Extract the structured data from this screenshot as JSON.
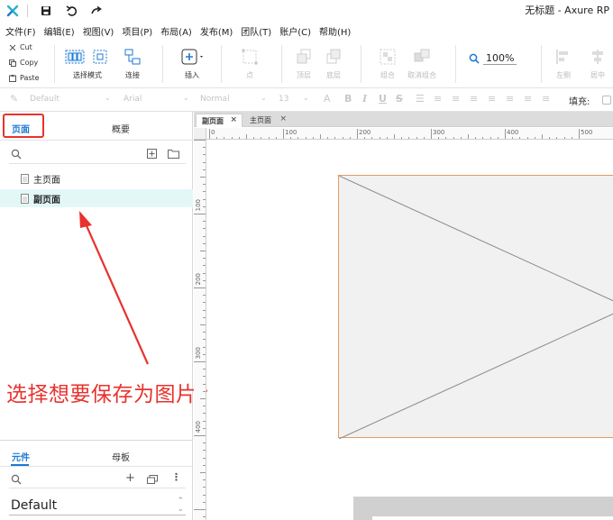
{
  "app": {
    "title": "无标题 - Axure RP"
  },
  "menu": [
    "文件(F)",
    "编辑(E)",
    "视图(V)",
    "项目(P)",
    "布局(A)",
    "发布(M)",
    "团队(T)",
    "账户(C)",
    "帮助(H)"
  ],
  "clipboard": {
    "cut": "Cut",
    "copy": "Copy",
    "paste": "Paste"
  },
  "toolbar": {
    "select_mode": "选择模式",
    "connect": "连接",
    "insert": "插入",
    "point": "点",
    "top_layer": "顶层",
    "bottom_layer": "底层",
    "group": "组合",
    "ungroup": "取消组合",
    "zoom": "100%",
    "left": "左侧",
    "center": "居中"
  },
  "format": {
    "style": "Default",
    "font": "Arial",
    "weight": "Normal",
    "size": "13",
    "fill_label": "填充:"
  },
  "left_panel": {
    "tab_pages": "页面",
    "tab_outline": "概要",
    "pages": [
      {
        "label": "主页面",
        "selected": false
      },
      {
        "label": "副页面",
        "selected": true
      }
    ],
    "tab_widgets": "元件",
    "tab_masters": "母板",
    "library": "Default"
  },
  "annotation": "选择想要保存为图片的页面",
  "doc_tabs": [
    {
      "label": "副页面",
      "active": true
    },
    {
      "label": "主页面",
      "active": false
    }
  ],
  "ruler": {
    "top": [
      "0",
      "100",
      "200",
      "300",
      "400",
      "500"
    ],
    "left": [
      "100",
      "200",
      "300",
      "400"
    ]
  },
  "colors": {
    "accent": "#1e7ad1",
    "annotation": "#e8322d",
    "selected_row": "#e3f7f7",
    "placeholder_border": "#e29a63"
  }
}
